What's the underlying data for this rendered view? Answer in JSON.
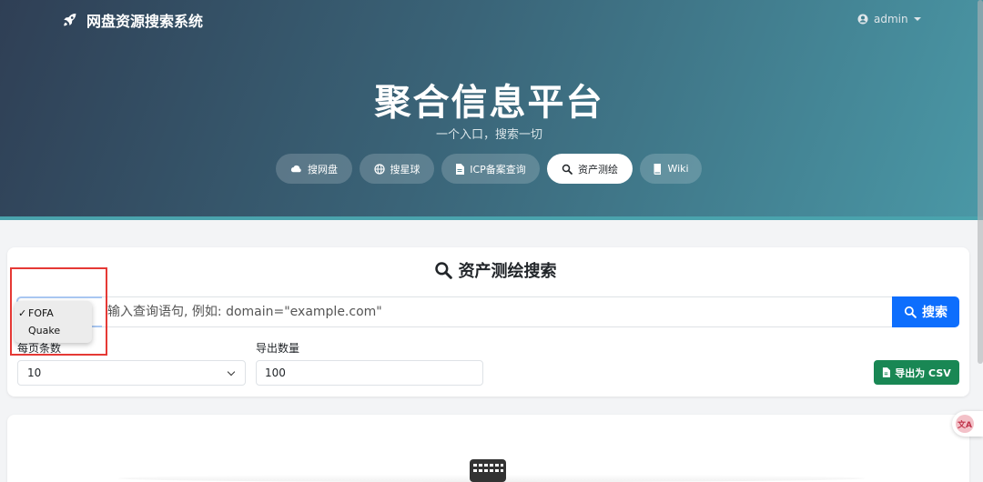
{
  "navbar": {
    "brand": "网盘资源搜索系统",
    "user": "admin"
  },
  "hero": {
    "title": "聚合信息平台",
    "subtitle": "一个入口，搜索一切"
  },
  "tabs": [
    {
      "label": "搜网盘",
      "icon": "cloud-icon",
      "active": false
    },
    {
      "label": "搜星球",
      "icon": "globe-icon",
      "active": false
    },
    {
      "label": "ICP备案查询",
      "icon": "document-icon",
      "active": false
    },
    {
      "label": "资产测绘",
      "icon": "search-icon",
      "active": true
    },
    {
      "label": "Wiki",
      "icon": "book-icon",
      "active": false
    }
  ],
  "search_card": {
    "title": "资产测绘搜索",
    "engine_options": [
      "FOFA",
      "Quake"
    ],
    "engine_selected": "FOFA",
    "query_placeholder": "输入查询语句, 例如: domain=\"example.com\"",
    "search_label": "搜索",
    "per_page_label": "每页条数",
    "per_page_value": "10",
    "export_count_label": "导出数量",
    "export_count_value": "100",
    "export_label": "导出为 CSV"
  },
  "colors": {
    "primary": "#0d6efd",
    "success": "#198754",
    "highlight": "#e53935"
  },
  "translate_fab": {
    "glyph": "文A"
  }
}
